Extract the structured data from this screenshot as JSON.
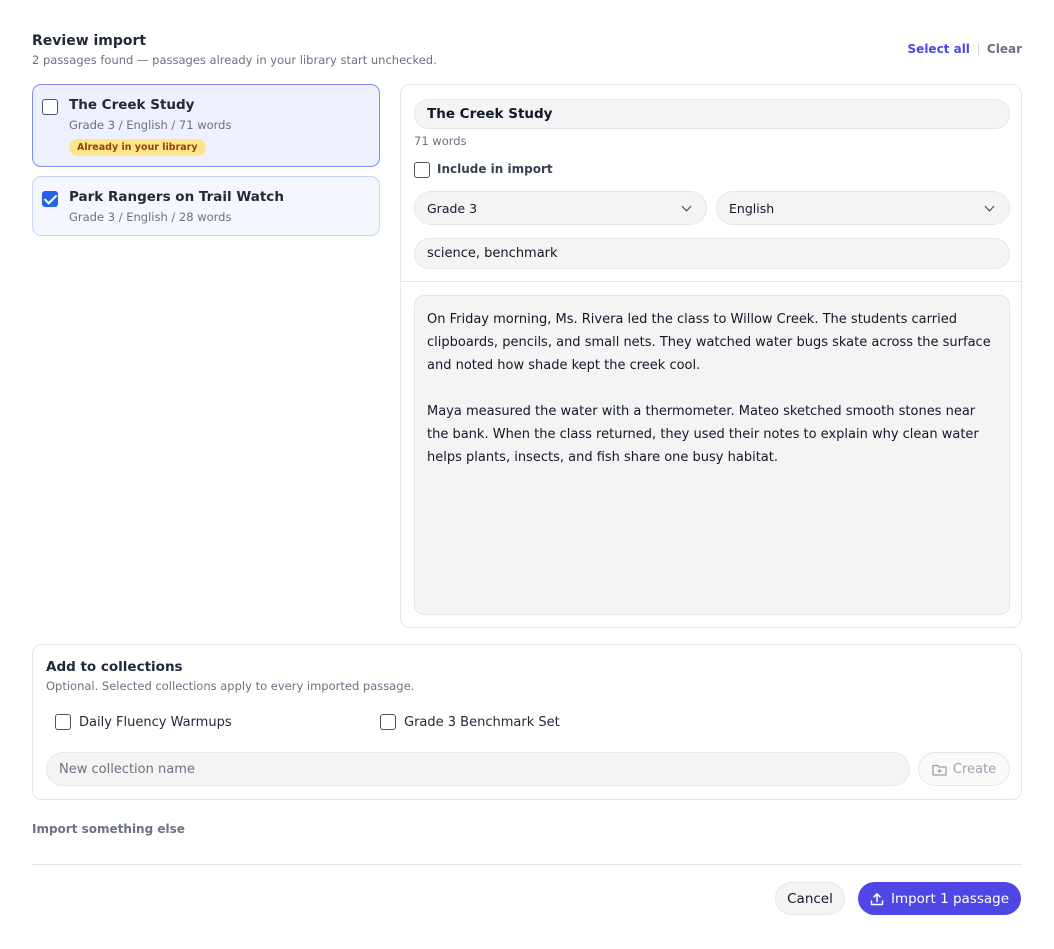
{
  "header": {
    "title": "Review import",
    "subtitle": "2 passages found — passages already in your library start unchecked.",
    "select_all": "Select all",
    "clear": "Clear"
  },
  "passages": [
    {
      "title": "The Creek Study",
      "meta": "Grade 3 / English / 71 words",
      "badge": "Already in your library",
      "checked": false
    },
    {
      "title": "Park Rangers on Trail Watch",
      "meta": "Grade 3 / English / 28 words",
      "checked": true
    }
  ],
  "editor": {
    "title_value": "The Creek Study",
    "word_count": "71 words",
    "include_label": "Include in import",
    "grade_value": "Grade 3",
    "language_value": "English",
    "tags_value": "science, benchmark",
    "paragraph_1": "On Friday morning, Ms. Rivera led the class to Willow Creek. The students carried clipboards, pencils, and small nets. They watched water bugs skate across the surface and noted how shade kept the creek cool.",
    "paragraph_2": "Maya measured the water with a thermometer. Mateo sketched smooth stones near the bank. When the class returned, they used their notes to explain why clean water helps plants, insects, and fish share one busy habitat."
  },
  "collections": {
    "title": "Add to collections",
    "subtitle": "Optional. Selected collections apply to every imported passage.",
    "options": [
      "Daily Fluency Warmups",
      "Grade 3 Benchmark Set"
    ],
    "new_placeholder": "New collection name",
    "create_label": "Create"
  },
  "footer": {
    "import_else": "Import something else",
    "cancel": "Cancel",
    "import": "Import 1 passage"
  },
  "colors": {
    "accent": "#4f46e5",
    "checkbox": "#2563eb",
    "badge_bg": "#fde68a",
    "badge_text": "#92400e"
  }
}
